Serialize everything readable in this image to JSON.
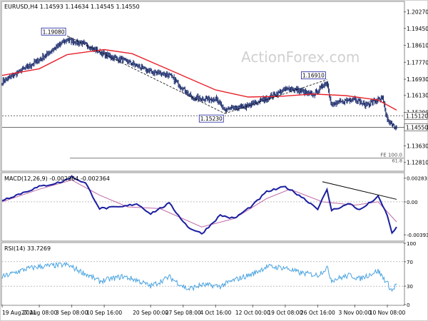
{
  "chart_data": [
    {
      "type": "candlestick",
      "panel": "price",
      "header": "EURUSD,H4  1.14593 1.14634 1.14545 1.14550",
      "ylim": [
        1.1241,
        1.2075
      ],
      "yticks": [
        1.2027,
        1.1945,
        1.1861,
        1.1777,
        1.1693,
        1.1613,
        1.1529,
        1.1455,
        1.1363,
        1.1281
      ],
      "ytick_labels": [
        "1.20270",
        "1.19450",
        "1.18610",
        "1.17770",
        "1.16930",
        "1.16130",
        "1.15290",
        "1.14550",
        "1.13630",
        "1.12810"
      ],
      "price_markers": [
        {
          "label": "1.15120",
          "value": 1.1512,
          "style": "dotted"
        },
        {
          "label": "1.14550",
          "value": 1.1455,
          "style": "solid"
        }
      ],
      "callouts": [
        {
          "label": "1.19080",
          "value": 1.1908,
          "date": "2 Sep 2021"
        },
        {
          "label": "1.15230",
          "value": 1.1523,
          "date": "6 Oct 2021"
        },
        {
          "label": "1.16910",
          "value": 1.1691,
          "date": "28 Oct 2021"
        }
      ],
      "fe_line": {
        "value": 1.1302,
        "labels": [
          "FE 100.0",
          "61.8"
        ]
      },
      "watermark": "ActionForex.com",
      "anchors": [
        {
          "date": "19 Aug 2021",
          "value": 1.168
        },
        {
          "date": "23 Aug 2021",
          "value": 1.1735
        },
        {
          "date": "27 Aug 2021",
          "value": 1.179
        },
        {
          "date": "2 Sep 2021",
          "value": 1.189
        },
        {
          "date": "6 Sep 2021",
          "value": 1.1865
        },
        {
          "date": "10 Sep 2021",
          "value": 1.1815
        },
        {
          "date": "15 Sep 2021",
          "value": 1.178
        },
        {
          "date": "20 Sep 2021",
          "value": 1.173
        },
        {
          "date": "24 Sep 2021",
          "value": 1.1715
        },
        {
          "date": "29 Sep 2021",
          "value": 1.16
        },
        {
          "date": "4 Oct 2021",
          "value": 1.1595
        },
        {
          "date": "6 Oct 2021",
          "value": 1.154
        },
        {
          "date": "11 Oct 2021",
          "value": 1.156
        },
        {
          "date": "15 Oct 2021",
          "value": 1.16
        },
        {
          "date": "20 Oct 2021",
          "value": 1.165
        },
        {
          "date": "25 Oct 2021",
          "value": 1.1615
        },
        {
          "date": "28 Oct 2021",
          "value": 1.168
        },
        {
          "date": "29 Oct 2021",
          "value": 1.1565
        },
        {
          "date": "3 Nov 2021",
          "value": 1.16
        },
        {
          "date": "5 Nov 2021",
          "value": 1.1565
        },
        {
          "date": "8 Nov 2021",
          "value": 1.159
        },
        {
          "date": "9 Nov 2021",
          "value": 1.1595
        },
        {
          "date": "10 Nov 2021",
          "value": 1.149
        },
        {
          "date": "11 Nov 2021",
          "value": 1.1465
        },
        {
          "date": "12 Nov 2021",
          "value": 1.1455
        }
      ],
      "moving_average": [
        {
          "date": "19 Aug 2021",
          "value": 1.1712
        },
        {
          "date": "27 Aug 2021",
          "value": 1.1745
        },
        {
          "date": "2 Sep 2021",
          "value": 1.1815
        },
        {
          "date": "10 Sep 2021",
          "value": 1.184
        },
        {
          "date": "16 Sep 2021",
          "value": 1.182
        },
        {
          "date": "22 Sep 2021",
          "value": 1.176
        },
        {
          "date": "28 Sep 2021",
          "value": 1.17
        },
        {
          "date": "4 Oct 2021",
          "value": 1.164
        },
        {
          "date": "11 Oct 2021",
          "value": 1.1605
        },
        {
          "date": "18 Oct 2021",
          "value": 1.1608
        },
        {
          "date": "25 Oct 2021",
          "value": 1.162
        },
        {
          "date": "1 Nov 2021",
          "value": 1.1612
        },
        {
          "date": "8 Nov 2021",
          "value": 1.159
        },
        {
          "date": "12 Nov 2021",
          "value": 1.154
        }
      ],
      "trendlines": [
        {
          "from": {
            "date": "2 Sep 2021",
            "value": 1.1908
          },
          "to": {
            "date": "6 Oct 2021",
            "value": 1.1523
          }
        },
        {
          "from": {
            "date": "6 Oct 2021",
            "value": 1.1523
          },
          "to": {
            "date": "28 Oct 2021",
            "value": 1.1691
          }
        }
      ]
    },
    {
      "type": "line",
      "panel": "macd",
      "header": "MACD(12,26,9) -0.002964 -0.002364",
      "ylim": [
        -0.0046,
        0.0034
      ],
      "yticks": [
        0.00283,
        0.0,
        -0.003939
      ],
      "ytick_labels": [
        "0.00283",
        "0.00",
        "-0.003939"
      ],
      "macd_anchors": [
        {
          "date": "19 Aug 2021",
          "value": 0.0002
        },
        {
          "date": "24 Aug 2021",
          "value": 0.0012
        },
        {
          "date": "27 Aug 2021",
          "value": 0.0018
        },
        {
          "date": "1 Sep 2021",
          "value": 0.0024
        },
        {
          "date": "3 Sep 2021",
          "value": 0.003
        },
        {
          "date": "6 Sep 2021",
          "value": 0.0022
        },
        {
          "date": "9 Sep 2021",
          "value": -0.0008
        },
        {
          "date": "14 Sep 2021",
          "value": -0.0006
        },
        {
          "date": "17 Sep 2021",
          "value": -0.0002
        },
        {
          "date": "20 Sep 2021",
          "value": -0.0014
        },
        {
          "date": "24 Sep 2021",
          "value": -0.0002
        },
        {
          "date": "28 Sep 2021",
          "value": -0.003
        },
        {
          "date": "1 Oct 2021",
          "value": -0.0038
        },
        {
          "date": "5 Oct 2021",
          "value": -0.0016
        },
        {
          "date": "8 Oct 2021",
          "value": -0.002
        },
        {
          "date": "12 Oct 2021",
          "value": -0.0004
        },
        {
          "date": "15 Oct 2021",
          "value": 0.0012
        },
        {
          "date": "19 Oct 2021",
          "value": 0.0018
        },
        {
          "date": "22 Oct 2021",
          "value": 0.0008
        },
        {
          "date": "26 Oct 2021",
          "value": -0.0008
        },
        {
          "date": "28 Oct 2021",
          "value": 0.0014
        },
        {
          "date": "29 Oct 2021",
          "value": -0.001
        },
        {
          "date": "2 Nov 2021",
          "value": -0.0002
        },
        {
          "date": "4 Nov 2021",
          "value": -0.001
        },
        {
          "date": "8 Nov 2021",
          "value": 0.0006
        },
        {
          "date": "10 Nov 2021",
          "value": -0.0016
        },
        {
          "date": "11 Nov 2021",
          "value": -0.0038
        },
        {
          "date": "12 Nov 2021",
          "value": -0.003
        }
      ],
      "signal_anchors": [
        {
          "date": "19 Aug 2021",
          "value": 0.0
        },
        {
          "date": "27 Aug 2021",
          "value": 0.0015
        },
        {
          "date": "3 Sep 2021",
          "value": 0.0026
        },
        {
          "date": "9 Sep 2021",
          "value": 0.0008
        },
        {
          "date": "15 Sep 2021",
          "value": -0.0006
        },
        {
          "date": "22 Sep 2021",
          "value": -0.0008
        },
        {
          "date": "1 Oct 2021",
          "value": -0.003
        },
        {
          "date": "8 Oct 2021",
          "value": -0.002
        },
        {
          "date": "15 Oct 2021",
          "value": 0.0004
        },
        {
          "date": "20 Oct 2021",
          "value": 0.0015
        },
        {
          "date": "27 Oct 2021",
          "value": 0.0
        },
        {
          "date": "3 Nov 2021",
          "value": -0.0004
        },
        {
          "date": "8 Nov 2021",
          "value": 0.0
        },
        {
          "date": "12 Nov 2021",
          "value": -0.0024
        }
      ],
      "trendline": {
        "from": {
          "date": "27 Oct 2021",
          "value": 0.0024
        },
        "to": {
          "date": "12 Nov 2021",
          "value": 0.0003
        }
      }
    },
    {
      "type": "line",
      "panel": "rsi",
      "header": "RSI(14) 33.7269",
      "ylim": [
        0,
        100
      ],
      "yticks": [
        100,
        70,
        30,
        0
      ],
      "ytick_labels": [
        "100",
        "70",
        "30",
        "0"
      ],
      "anchors": [
        {
          "date": "19 Aug 2021",
          "value": 45
        },
        {
          "date": "24 Aug 2021",
          "value": 58
        },
        {
          "date": "27 Aug 2021",
          "value": 62
        },
        {
          "date": "2 Sep 2021",
          "value": 65
        },
        {
          "date": "6 Sep 2021",
          "value": 50
        },
        {
          "date": "9 Sep 2021",
          "value": 38
        },
        {
          "date": "14 Sep 2021",
          "value": 46
        },
        {
          "date": "17 Sep 2021",
          "value": 40
        },
        {
          "date": "20 Sep 2021",
          "value": 30
        },
        {
          "date": "24 Sep 2021",
          "value": 45
        },
        {
          "date": "28 Sep 2021",
          "value": 25
        },
        {
          "date": "1 Oct 2021",
          "value": 32
        },
        {
          "date": "5 Oct 2021",
          "value": 30
        },
        {
          "date": "8 Oct 2021",
          "value": 40
        },
        {
          "date": "12 Oct 2021",
          "value": 50
        },
        {
          "date": "15 Oct 2021",
          "value": 62
        },
        {
          "date": "19 Oct 2021",
          "value": 60
        },
        {
          "date": "22 Oct 2021",
          "value": 52
        },
        {
          "date": "26 Oct 2021",
          "value": 48
        },
        {
          "date": "28 Oct 2021",
          "value": 60
        },
        {
          "date": "29 Oct 2021",
          "value": 40
        },
        {
          "date": "2 Nov 2021",
          "value": 48
        },
        {
          "date": "4 Nov 2021",
          "value": 42
        },
        {
          "date": "8 Nov 2021",
          "value": 55
        },
        {
          "date": "10 Nov 2021",
          "value": 35
        },
        {
          "date": "11 Nov 2021",
          "value": 22
        },
        {
          "date": "12 Nov 2021",
          "value": 34
        }
      ]
    }
  ],
  "x_axis": {
    "start": "19 Aug 2021",
    "end": "12 Nov 2021",
    "ticks": [
      {
        "label": "19 Aug 2021",
        "date": "19 Aug 2021"
      },
      {
        "label": "27 Aug 08:00",
        "date": "27 Aug 2021"
      },
      {
        "label": "3 Sep 08:00",
        "date": "3 Sep 2021"
      },
      {
        "label": "10 Sep 16:00",
        "date": "10 Sep 2021"
      },
      {
        "label": "20 Sep 00:00",
        "date": "20 Sep 2021"
      },
      {
        "label": "27 Sep 08:00",
        "date": "27 Sep 2021"
      },
      {
        "label": "4 Oct 16:00",
        "date": "4 Oct 2021"
      },
      {
        "label": "12 Oct 00:00",
        "date": "12 Oct 2021"
      },
      {
        "label": "19 Oct 08:00",
        "date": "19 Oct 2021"
      },
      {
        "label": "26 Oct 16:00",
        "date": "26 Oct 2021"
      },
      {
        "label": "3 Nov 00:00",
        "date": "3 Nov 2021"
      },
      {
        "label": "10 Nov 08:00",
        "date": "10 Nov 2021"
      }
    ]
  },
  "colors": {
    "price": "#1f2f6e",
    "ma": "#e8202a",
    "trend": "#000000",
    "macd": "#1b1fa0",
    "signal": "#c06aa6",
    "rsi": "#4aa3e0",
    "grid": "#b4b4b4",
    "callout_border": "#1b1fa0"
  }
}
